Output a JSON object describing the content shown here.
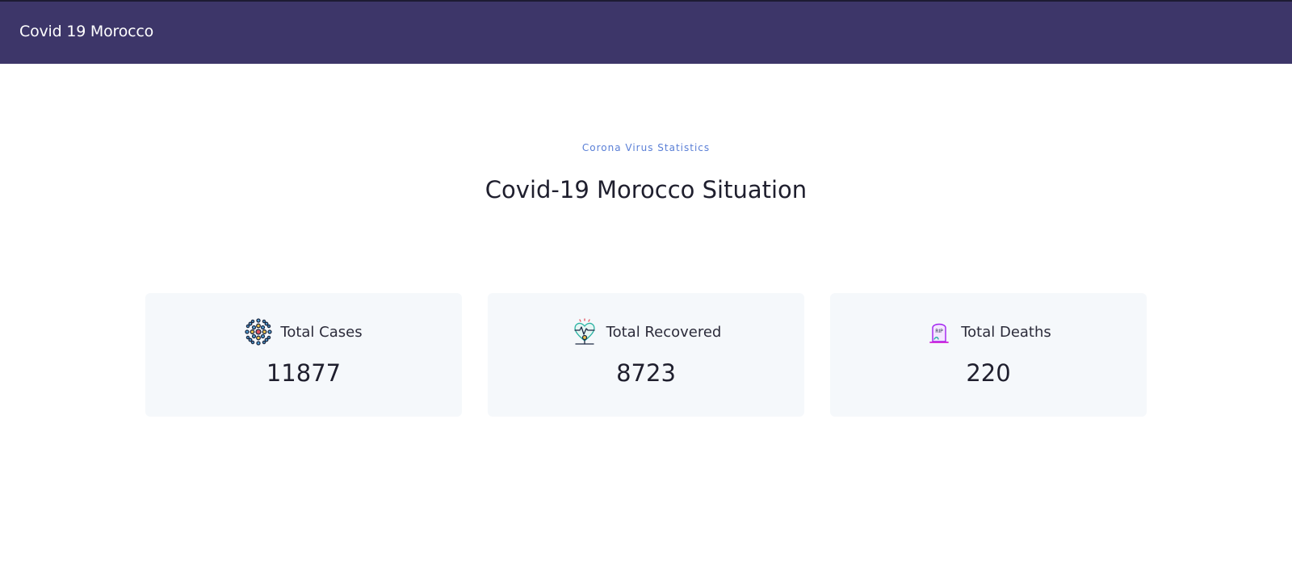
{
  "navbar": {
    "brand": "Covid 19 Morocco"
  },
  "section": {
    "subtitle": "Corona Virus Statistics",
    "title": "Covid-19 Morocco Situation"
  },
  "cards": [
    {
      "label": "Total Cases",
      "value": "11877",
      "icon": "virus-icon"
    },
    {
      "label": "Total Recovered",
      "value": "8723",
      "icon": "heart-pulse-icon"
    },
    {
      "label": "Total Deaths",
      "value": "220",
      "icon": "tombstone-rip-icon"
    }
  ],
  "colors": {
    "navbar": "#3d3669",
    "accent": "#5a7fd6",
    "card_bg": "#f5f8fb"
  }
}
